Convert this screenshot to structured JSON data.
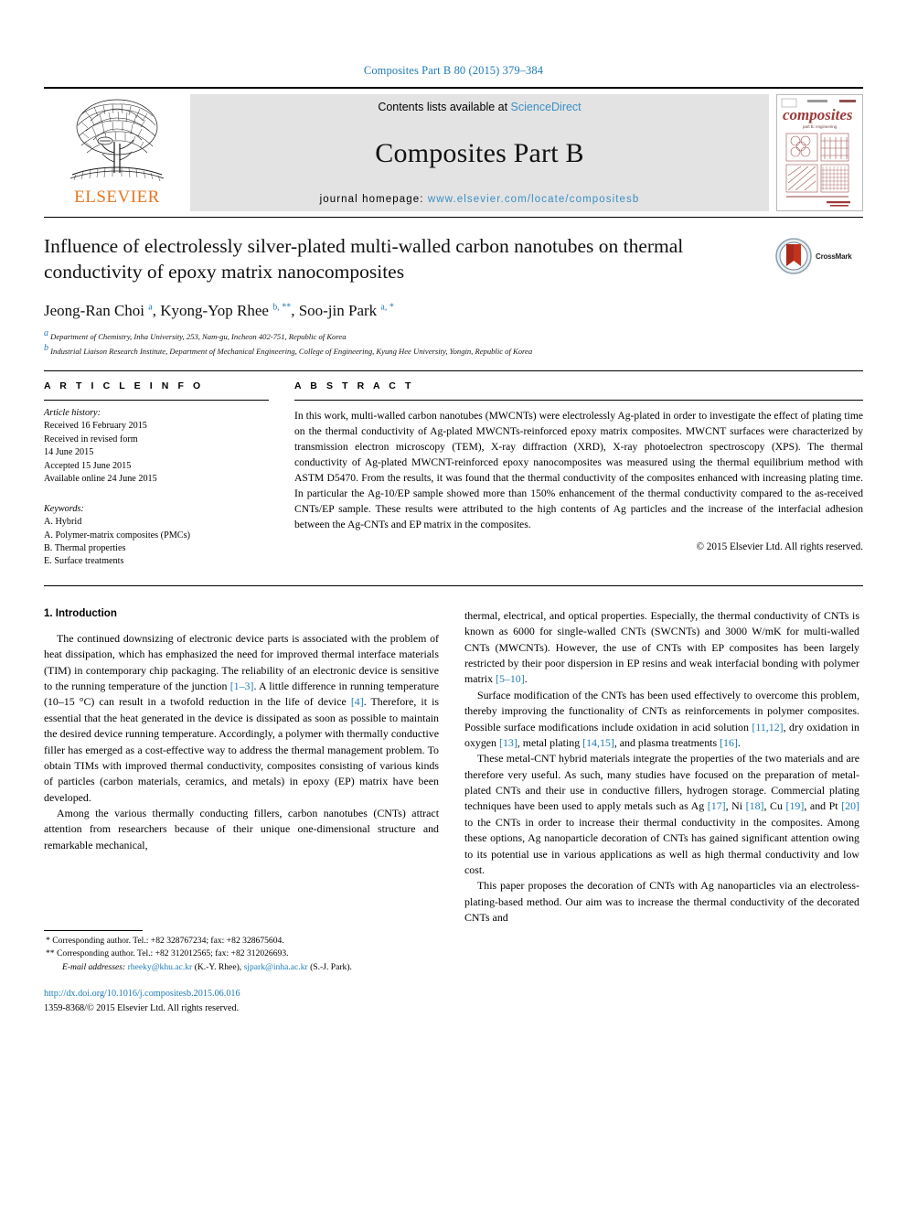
{
  "running_head": "Composites Part B 80 (2015) 379–384",
  "masthead": {
    "publisher": "ELSEVIER",
    "contents_prefix": "Contents lists available at ",
    "contents_link": "ScienceDirect",
    "journal_title": "Composites Part B",
    "homepage_prefix": "journal homepage: ",
    "homepage_url": "www.elsevier.com/locate/compositesb",
    "cover_word": "composites",
    "cover_subtitle": "part B: engineering"
  },
  "article": {
    "title": "Influence of electrolessly silver-plated multi-walled carbon nanotubes on thermal conductivity of epoxy matrix nanocomposites",
    "crossmark_label": "CrossMark",
    "authors_html": "Jeong-Ran Choi <sup>a</sup>, Kyong-Yop Rhee <sup>b, **</sup>, Soo-jin Park <sup>a, *</sup>",
    "affiliations": [
      "a Department of Chemistry, Inha University, 253, Nam-gu, Incheon 402-751, Republic of Korea",
      "b Industrial Liaison Research Institute, Department of Mechanical Engineering, College of Engineering, Kyung Hee University, Yongin, Republic of Korea"
    ]
  },
  "article_info": {
    "heading": "A R T I C L E  I N F O",
    "history_label": "Article history:",
    "history": [
      "Received 16 February 2015",
      "Received in revised form",
      "14 June 2015",
      "Accepted 15 June 2015",
      "Available online 24 June 2015"
    ],
    "keywords_label": "Keywords:",
    "keywords": [
      "A. Hybrid",
      "A. Polymer-matrix composites (PMCs)",
      "B. Thermal properties",
      "E. Surface treatments"
    ]
  },
  "abstract": {
    "heading": "A B S T R A C T",
    "text": "In this work, multi-walled carbon nanotubes (MWCNTs) were electrolessly Ag-plated in order to investigate the effect of plating time on the thermal conductivity of Ag-plated MWCNTs-reinforced epoxy matrix composites. MWCNT surfaces were characterized by transmission electron microscopy (TEM), X-ray diffraction (XRD), X-ray photoelectron spectroscopy (XPS). The thermal conductivity of Ag-plated MWCNT-reinforced epoxy nanocomposites was measured using the thermal equilibrium method with ASTM D5470. From the results, it was found that the thermal conductivity of the composites enhanced with increasing plating time. In particular the Ag-10/EP sample showed more than 150% enhancement of the thermal conductivity compared to the as-received CNTs/EP sample. These results were attributed to the high contents of Ag particles and the increase of the interfacial adhesion between the Ag-CNTs and EP matrix in the composites.",
    "copyright": "© 2015 Elsevier Ltd. All rights reserved."
  },
  "body": {
    "section_title": "1. Introduction",
    "left_paragraphs": [
      "The continued downsizing of electronic device parts is associated with the problem of heat dissipation, which has emphasized the need for improved thermal interface materials (TIM) in contemporary chip packaging. The reliability of an electronic device is sensitive to the running temperature of the junction [1–3]. A little difference in running temperature (10–15 °C) can result in a twofold reduction in the life of device [4]. Therefore, it is essential that the heat generated in the device is dissipated as soon as possible to maintain the desired device running temperature. Accordingly, a polymer with thermally conductive filler has emerged as a cost-effective way to address the thermal management problem. To obtain TIMs with improved thermal conductivity, composites consisting of various kinds of particles (carbon materials, ceramics, and metals) in epoxy (EP) matrix have been developed.",
      "Among the various thermally conducting fillers, carbon nanotubes (CNTs) attract attention from researchers because of their unique one-dimensional structure and remarkable mechanical,"
    ],
    "right_paragraphs": [
      "thermal, electrical, and optical properties. Especially, the thermal conductivity of CNTs is known as 6000 for single-walled CNTs (SWCNTs) and 3000 W/mK for multi-walled CNTs (MWCNTs). However, the use of CNTs with EP composites has been largely restricted by their poor dispersion in EP resins and weak interfacial bonding with polymer matrix [5–10].",
      "Surface modification of the CNTs has been used effectively to overcome this problem, thereby improving the functionality of CNTs as reinforcements in polymer composites. Possible surface modifications include oxidation in acid solution [11,12], dry oxidation in oxygen [13], metal plating [14,15], and plasma treatments [16].",
      "These metal-CNT hybrid materials integrate the properties of the two materials and are therefore very useful. As such, many studies have focused on the preparation of metal-plated CNTs and their use in conductive fillers, hydrogen storage. Commercial plating techniques have been used to apply metals such as Ag [17], Ni [18], Cu [19], and Pt [20] to the CNTs in order to increase their thermal conductivity in the composites. Among these options, Ag nanoparticle decoration of CNTs has gained significant attention owing to its potential use in various applications as well as high thermal conductivity and low cost.",
      "This paper proposes the decoration of CNTs with Ag nanoparticles via an electroless-plating-based method. Our aim was to increase the thermal conductivity of the decorated CNTs and"
    ]
  },
  "footnotes": {
    "corresponding_1": "* Corresponding author. Tel.: +82 328767234; fax: +82 328675604.",
    "corresponding_2": "** Corresponding author. Tel.: +82 312012565; fax: +82 312026693.",
    "email_label": "E-mail addresses:",
    "email_1": "rheeky@khu.ac.kr",
    "email_1_name": "(K.-Y. Rhee),",
    "email_2": "sjpark@inha.ac.kr",
    "email_2_name": "(S.-J. Park).",
    "doi": "http://dx.doi.org/10.1016/j.compositesb.2015.06.016",
    "issn_line": "1359-8368/© 2015 Elsevier Ltd. All rights reserved."
  },
  "colors": {
    "link_blue": "#1f7bb6",
    "elsevier_orange": "#e87722",
    "banner_gray": "#e3e3e3",
    "cover_red": "#9e3a3a"
  }
}
